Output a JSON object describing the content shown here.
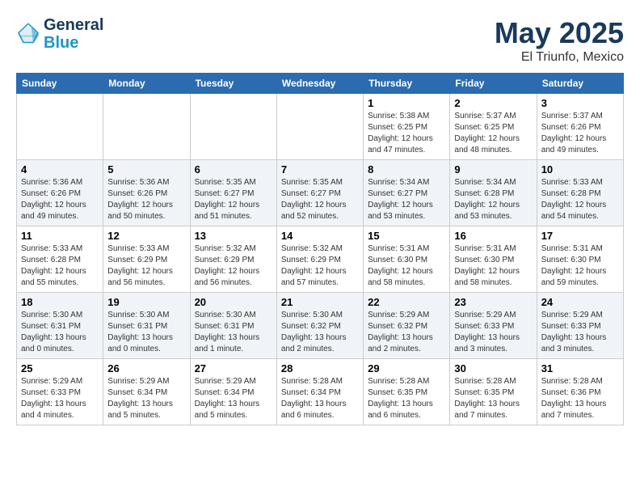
{
  "header": {
    "logo_line1": "General",
    "logo_line2": "Blue",
    "month": "May 2025",
    "location": "El Triunfo, Mexico"
  },
  "days_of_week": [
    "Sunday",
    "Monday",
    "Tuesday",
    "Wednesday",
    "Thursday",
    "Friday",
    "Saturday"
  ],
  "weeks": [
    [
      {
        "day": "",
        "info": ""
      },
      {
        "day": "",
        "info": ""
      },
      {
        "day": "",
        "info": ""
      },
      {
        "day": "",
        "info": ""
      },
      {
        "day": "1",
        "info": "Sunrise: 5:38 AM\nSunset: 6:25 PM\nDaylight: 12 hours\nand 47 minutes."
      },
      {
        "day": "2",
        "info": "Sunrise: 5:37 AM\nSunset: 6:25 PM\nDaylight: 12 hours\nand 48 minutes."
      },
      {
        "day": "3",
        "info": "Sunrise: 5:37 AM\nSunset: 6:26 PM\nDaylight: 12 hours\nand 49 minutes."
      }
    ],
    [
      {
        "day": "4",
        "info": "Sunrise: 5:36 AM\nSunset: 6:26 PM\nDaylight: 12 hours\nand 49 minutes."
      },
      {
        "day": "5",
        "info": "Sunrise: 5:36 AM\nSunset: 6:26 PM\nDaylight: 12 hours\nand 50 minutes."
      },
      {
        "day": "6",
        "info": "Sunrise: 5:35 AM\nSunset: 6:27 PM\nDaylight: 12 hours\nand 51 minutes."
      },
      {
        "day": "7",
        "info": "Sunrise: 5:35 AM\nSunset: 6:27 PM\nDaylight: 12 hours\nand 52 minutes."
      },
      {
        "day": "8",
        "info": "Sunrise: 5:34 AM\nSunset: 6:27 PM\nDaylight: 12 hours\nand 53 minutes."
      },
      {
        "day": "9",
        "info": "Sunrise: 5:34 AM\nSunset: 6:28 PM\nDaylight: 12 hours\nand 53 minutes."
      },
      {
        "day": "10",
        "info": "Sunrise: 5:33 AM\nSunset: 6:28 PM\nDaylight: 12 hours\nand 54 minutes."
      }
    ],
    [
      {
        "day": "11",
        "info": "Sunrise: 5:33 AM\nSunset: 6:28 PM\nDaylight: 12 hours\nand 55 minutes."
      },
      {
        "day": "12",
        "info": "Sunrise: 5:33 AM\nSunset: 6:29 PM\nDaylight: 12 hours\nand 56 minutes."
      },
      {
        "day": "13",
        "info": "Sunrise: 5:32 AM\nSunset: 6:29 PM\nDaylight: 12 hours\nand 56 minutes."
      },
      {
        "day": "14",
        "info": "Sunrise: 5:32 AM\nSunset: 6:29 PM\nDaylight: 12 hours\nand 57 minutes."
      },
      {
        "day": "15",
        "info": "Sunrise: 5:31 AM\nSunset: 6:30 PM\nDaylight: 12 hours\nand 58 minutes."
      },
      {
        "day": "16",
        "info": "Sunrise: 5:31 AM\nSunset: 6:30 PM\nDaylight: 12 hours\nand 58 minutes."
      },
      {
        "day": "17",
        "info": "Sunrise: 5:31 AM\nSunset: 6:30 PM\nDaylight: 12 hours\nand 59 minutes."
      }
    ],
    [
      {
        "day": "18",
        "info": "Sunrise: 5:30 AM\nSunset: 6:31 PM\nDaylight: 13 hours\nand 0 minutes."
      },
      {
        "day": "19",
        "info": "Sunrise: 5:30 AM\nSunset: 6:31 PM\nDaylight: 13 hours\nand 0 minutes."
      },
      {
        "day": "20",
        "info": "Sunrise: 5:30 AM\nSunset: 6:31 PM\nDaylight: 13 hours\nand 1 minute."
      },
      {
        "day": "21",
        "info": "Sunrise: 5:30 AM\nSunset: 6:32 PM\nDaylight: 13 hours\nand 2 minutes."
      },
      {
        "day": "22",
        "info": "Sunrise: 5:29 AM\nSunset: 6:32 PM\nDaylight: 13 hours\nand 2 minutes."
      },
      {
        "day": "23",
        "info": "Sunrise: 5:29 AM\nSunset: 6:33 PM\nDaylight: 13 hours\nand 3 minutes."
      },
      {
        "day": "24",
        "info": "Sunrise: 5:29 AM\nSunset: 6:33 PM\nDaylight: 13 hours\nand 3 minutes."
      }
    ],
    [
      {
        "day": "25",
        "info": "Sunrise: 5:29 AM\nSunset: 6:33 PM\nDaylight: 13 hours\nand 4 minutes."
      },
      {
        "day": "26",
        "info": "Sunrise: 5:29 AM\nSunset: 6:34 PM\nDaylight: 13 hours\nand 5 minutes."
      },
      {
        "day": "27",
        "info": "Sunrise: 5:29 AM\nSunset: 6:34 PM\nDaylight: 13 hours\nand 5 minutes."
      },
      {
        "day": "28",
        "info": "Sunrise: 5:28 AM\nSunset: 6:34 PM\nDaylight: 13 hours\nand 6 minutes."
      },
      {
        "day": "29",
        "info": "Sunrise: 5:28 AM\nSunset: 6:35 PM\nDaylight: 13 hours\nand 6 minutes."
      },
      {
        "day": "30",
        "info": "Sunrise: 5:28 AM\nSunset: 6:35 PM\nDaylight: 13 hours\nand 7 minutes."
      },
      {
        "day": "31",
        "info": "Sunrise: 5:28 AM\nSunset: 6:36 PM\nDaylight: 13 hours\nand 7 minutes."
      }
    ]
  ]
}
